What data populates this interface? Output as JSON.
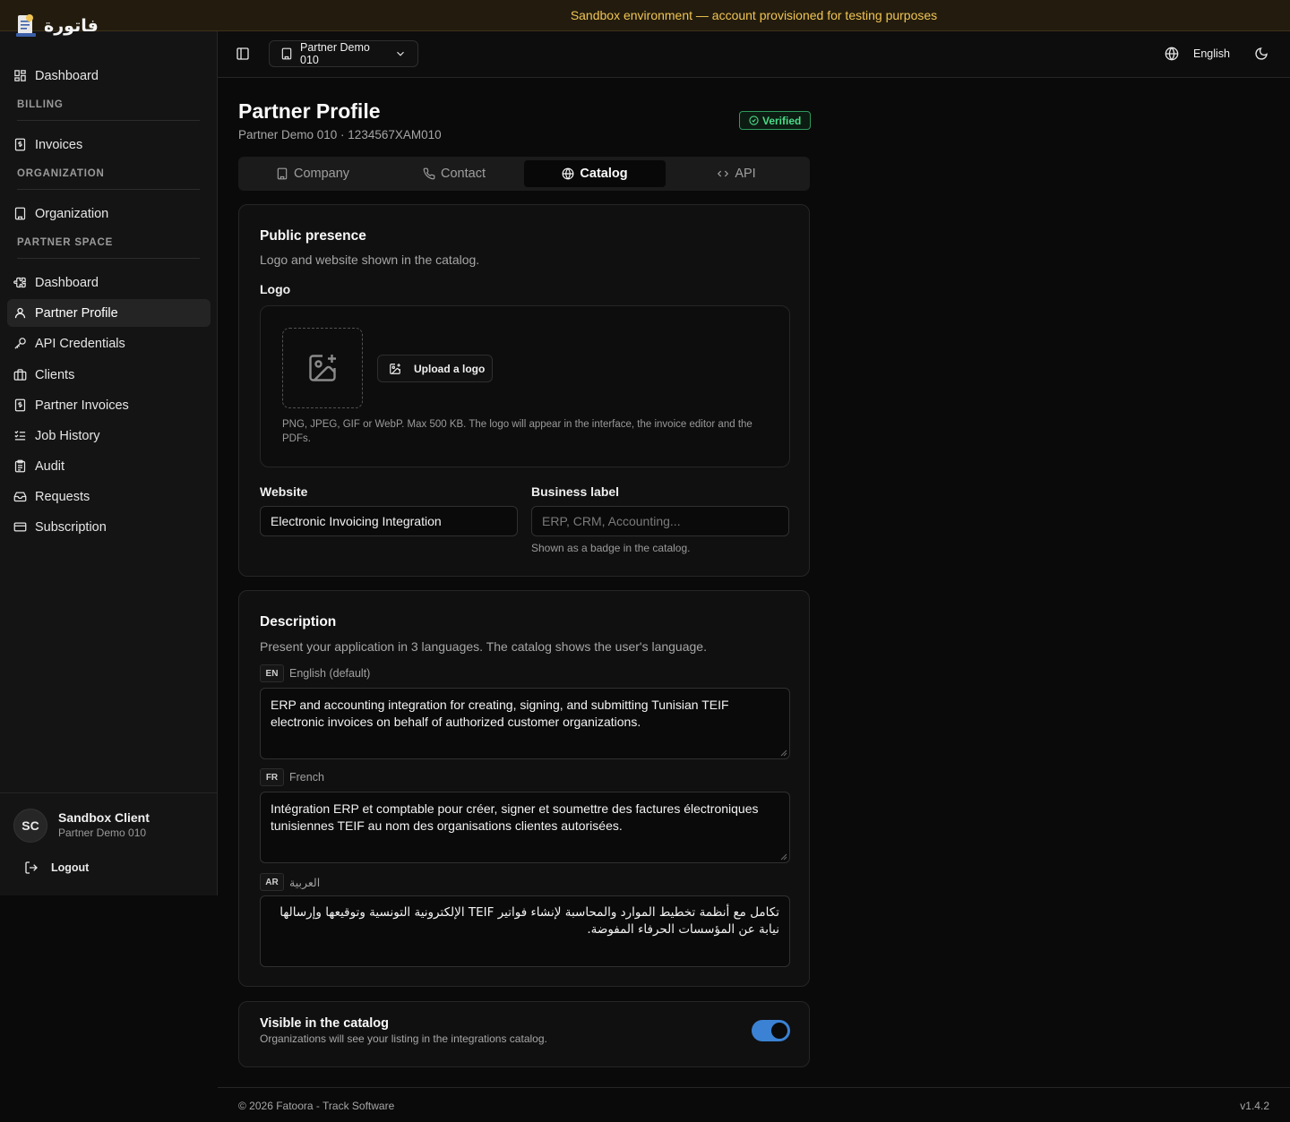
{
  "banner": {
    "text": "Sandbox environment — account provisioned for testing purposes"
  },
  "brand": {
    "name": "فاتورة",
    "logo_icon": "invoice-logo-icon"
  },
  "sidebar": {
    "top_item": {
      "label": "Dashboard",
      "icon": "dashboard-grid-icon"
    },
    "sections": [
      {
        "title": "BILLING",
        "items": [
          {
            "label": "Invoices",
            "icon": "invoice-icon"
          }
        ]
      },
      {
        "title": "ORGANIZATION",
        "items": [
          {
            "label": "Organization",
            "icon": "building-icon"
          }
        ]
      },
      {
        "title": "PARTNER SPACE",
        "items": [
          {
            "label": "Dashboard",
            "icon": "puzzle-icon"
          },
          {
            "label": "Partner Profile",
            "icon": "user-icon",
            "active": true
          },
          {
            "label": "API Credentials",
            "icon": "key-icon"
          },
          {
            "label": "Clients",
            "icon": "briefcase-icon"
          },
          {
            "label": "Partner Invoices",
            "icon": "invoice-icon"
          },
          {
            "label": "Job History",
            "icon": "checklist-icon"
          },
          {
            "label": "Audit",
            "icon": "clipboard-icon"
          },
          {
            "label": "Requests",
            "icon": "inbox-icon"
          },
          {
            "label": "Subscription",
            "icon": "credit-card-icon"
          }
        ]
      }
    ],
    "user": {
      "initials": "SC",
      "name": "Sandbox Client",
      "org": "Partner Demo 010"
    },
    "logout_label": "Logout"
  },
  "topbar": {
    "org_select": "Partner Demo 010",
    "language": "English"
  },
  "page": {
    "title": "Partner Profile",
    "subtitle": "Partner Demo 010 · 1234567XAM010",
    "status_badge": "Verified"
  },
  "tabs": [
    {
      "label": "Company",
      "icon": "building-icon"
    },
    {
      "label": "Contact",
      "icon": "phone-icon"
    },
    {
      "label": "Catalog",
      "icon": "globe-icon",
      "active": true
    },
    {
      "label": "API",
      "icon": "code-icon"
    }
  ],
  "public_presence": {
    "title": "Public presence",
    "description": "Logo and website shown in the catalog.",
    "logo_label": "Logo",
    "upload_button": "Upload a logo",
    "logo_hint": "PNG, JPEG, GIF or WebP. Max 500 KB. The logo will appear in the interface, the invoice editor and the PDFs.",
    "website_label": "Website",
    "website_value": "Electronic Invoicing Integration",
    "business_label": "Business label",
    "business_placeholder": "ERP, CRM, Accounting...",
    "business_hint": "Shown as a badge in the catalog."
  },
  "description_card": {
    "title": "Description",
    "description": "Present your application in 3 languages. The catalog shows the user's language.",
    "languages": [
      {
        "code": "EN",
        "name": "English (default)",
        "text": "ERP and accounting integration for creating, signing, and submitting Tunisian TEIF electronic invoices on behalf of authorized customer organizations."
      },
      {
        "code": "FR",
        "name": "French",
        "text": "Intégration ERP et comptable pour créer, signer et soumettre des factures électroniques tunisiennes TEIF au nom des organisations clientes autorisées."
      },
      {
        "code": "AR",
        "name": "العربية",
        "text": "تكامل مع أنظمة تخطيط الموارد والمحاسبة لإنشاء فواتير TEIF الإلكترونية التونسية وتوقيعها وإرسالها نيابة عن المؤسسات الحرفاء المفوضة."
      }
    ]
  },
  "visibility": {
    "title": "Visible in the catalog",
    "description": "Organizations will see your listing in the integrations catalog.",
    "enabled": true,
    "accent": "#3b82d4"
  },
  "footer": {
    "copyright": "© 2026 Fatoora - Track Software",
    "version": "v1.4.2"
  }
}
